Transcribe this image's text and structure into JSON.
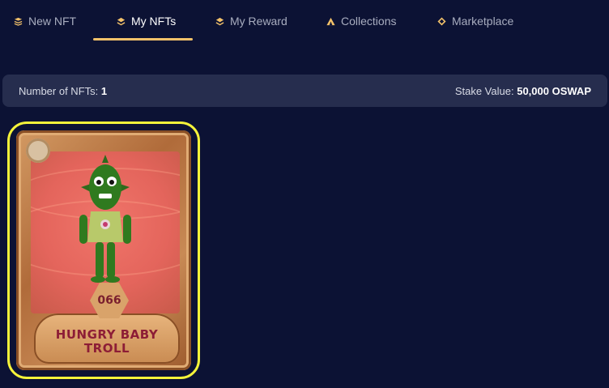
{
  "tabs": [
    {
      "label": "New NFT",
      "icon": "stack-icon"
    },
    {
      "label": "My NFTs",
      "icon": "layers-icon",
      "active": true
    },
    {
      "label": "My Reward",
      "icon": "layers-icon"
    },
    {
      "label": "Collections",
      "icon": "tent-icon"
    },
    {
      "label": "Marketplace",
      "icon": "diamond-icon"
    }
  ],
  "summary": {
    "count_label": "Number of NFTs:",
    "count_value": "1",
    "stake_label": "Stake Value:",
    "stake_value": "50,000 OSWAP"
  },
  "nft_card": {
    "number": "066",
    "name_line1": "HUNGRY BABY",
    "name_line2": "TROLL"
  },
  "colors": {
    "background": "#0c1234",
    "accent": "#f3c26a",
    "selection_outline": "#f5f33a",
    "card_name": "#8d1d36"
  }
}
